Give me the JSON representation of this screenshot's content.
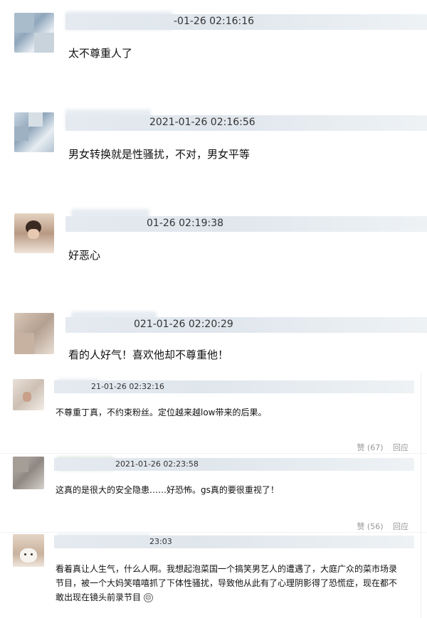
{
  "comments": [
    {
      "timestamp": "-01-26 02:16:16",
      "text": "太不尊重人了"
    },
    {
      "timestamp": "2021-01-26 02:16:56",
      "text": "男女转换就是性骚扰，不对，男女平等"
    },
    {
      "timestamp": "01-26 02:19:38",
      "text": "好恶心"
    },
    {
      "timestamp": "021-01-26 02:20:29",
      "text": "看的人好气！喜欢他却不尊重他！"
    },
    {
      "timestamp": "21-01-26 02:32:16",
      "text": "不尊重丁真，不约束粉丝。定位越来越low带来的后果。",
      "like_label": "赞 (67)",
      "reply_label": "回应"
    },
    {
      "timestamp": "2021-01-26 02:23:58",
      "text": "这真的是很大的安全隐患……好恐怖。gs真的要很重视了！",
      "like_label": "赞 (56)",
      "reply_label": "回应"
    },
    {
      "timestamp": "23:03",
      "text_line1": "看着真让人生气，什么人啊。我想起泡菜国一个搞笑男艺人的遭遇了，大庭广众的菜市场录",
      "text_line2": "节目，被一个大妈笑嘻嘻抓了下体性骚扰，导致他从此有了心理阴影得了恐慌症，现在都不",
      "text_line3": "敢出现在镜头前录节目"
    }
  ],
  "icons": {
    "sad_emoji": "sad-emoji-icon"
  }
}
